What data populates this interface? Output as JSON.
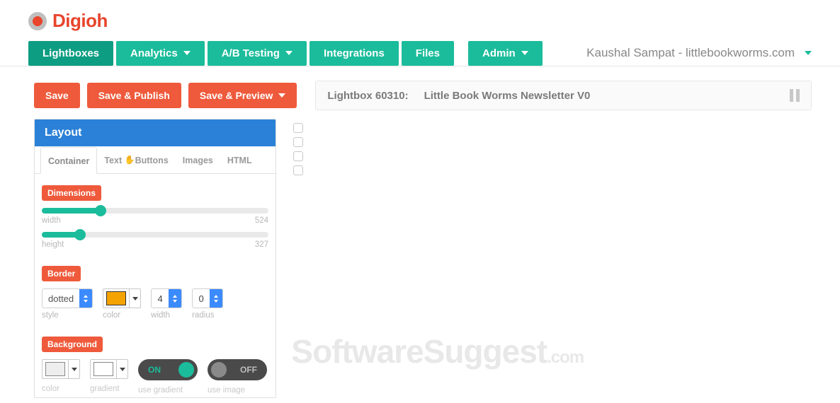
{
  "brand": "Digioh",
  "nav": {
    "lightboxes": "Lightboxes",
    "analytics": "Analytics",
    "abtesting": "A/B Testing",
    "integrations": "Integrations",
    "files": "Files",
    "admin": "Admin"
  },
  "user_label": "Kaushal Sampat - littlebookworms.com",
  "actions": {
    "save": "Save",
    "save_publish": "Save & Publish",
    "save_preview": "Save & Preview"
  },
  "title_bar": {
    "id_label": "Lightbox 60310:",
    "name": "Little Book Worms Newsletter V0"
  },
  "panel": {
    "header": "Layout",
    "tabs": {
      "container": "Container",
      "text": "Text",
      "buttons": "Buttons",
      "images": "Images",
      "html": "HTML"
    },
    "dimensions": {
      "badge": "Dimensions",
      "width_label": "width",
      "width_value": "524",
      "width_pct": 26,
      "height_label": "height",
      "height_value": "327",
      "height_pct": 17
    },
    "border": {
      "badge": "Border",
      "style_value": "dotted",
      "style_label": "style",
      "color_hex": "#f5a300",
      "color_label": "color",
      "width_value": "4",
      "width_label": "width",
      "radius_value": "0",
      "radius_label": "radius"
    },
    "background": {
      "badge": "Background",
      "color_hex": "#eeeeee",
      "color_label": "color",
      "gradient_hex": "#ffffff",
      "gradient_label": "gradient",
      "toggle_on": "ON",
      "toggle_on_label": "use gradient",
      "toggle_off": "OFF",
      "toggle_off_label": "use image"
    }
  },
  "watermark_main": "SoftwareSuggest",
  "watermark_suffix": ".com"
}
